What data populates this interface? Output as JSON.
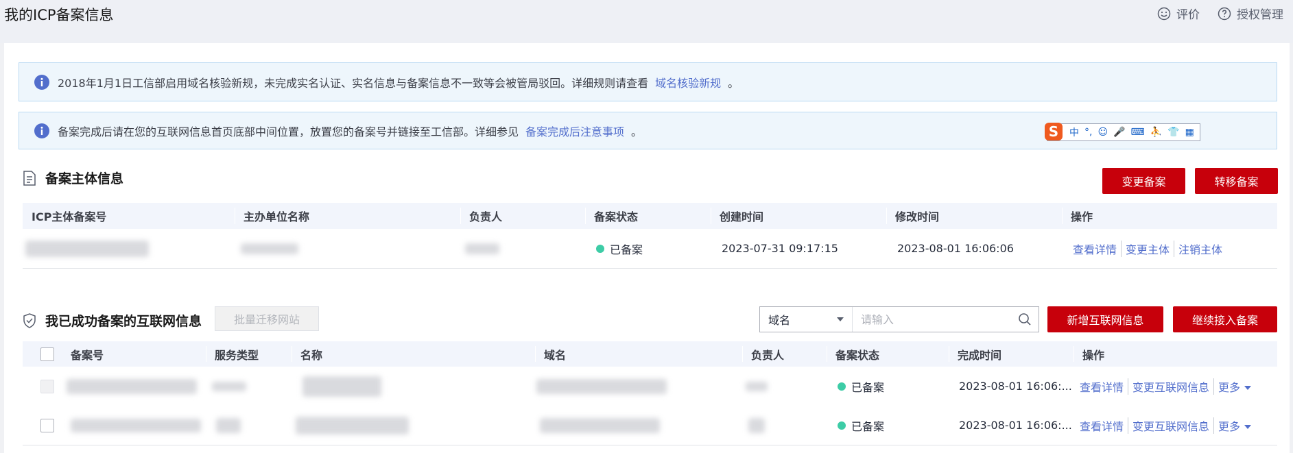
{
  "header": {
    "title": "我的ICP备案信息",
    "rate_label": "评价",
    "auth_label": "授权管理"
  },
  "notices": [
    {
      "text": "2018年1月1日工信部启用域名核验新规，未完成实名认证、实名信息与备案信息不一致等会被管局驳回。详细规则请查看",
      "link": "域名核验新规",
      "end": "。"
    },
    {
      "text": "备案完成后请在您的互联网信息首页底部中间位置，放置您的备案号并链接至工信部。详细参见",
      "link": "备案完成后注意事项",
      "end": "。"
    }
  ],
  "ime_toolbar": {
    "logo": "S",
    "glyphs": [
      "中",
      "°,",
      "☺",
      "🎤",
      "⌨",
      "⛹",
      "👕",
      "▦"
    ]
  },
  "entity": {
    "title": "备案主体信息",
    "buttons": {
      "change": "变更备案",
      "transfer": "转移备案"
    },
    "columns": [
      "ICP主体备案号",
      "主办单位名称",
      "负责人",
      "备案状态",
      "创建时间",
      "修改时间",
      "操作"
    ],
    "row": {
      "status": "已备案",
      "created": "2023-07-31 09:17:15",
      "modified": "2023-08-01 16:06:06",
      "actions": [
        "查看详情",
        "变更主体",
        "注销主体"
      ]
    }
  },
  "sites": {
    "title": "我已成功备案的互联网信息",
    "batch_button": "批量迁移网站",
    "search": {
      "select_value": "域名",
      "placeholder": "请输入"
    },
    "buttons": {
      "add": "新增互联网信息",
      "continue": "继续接入备案"
    },
    "columns": [
      "备案号",
      "服务类型",
      "名称",
      "域名",
      "负责人",
      "备案状态",
      "完成时间",
      "操作"
    ],
    "rows": [
      {
        "status": "已备案",
        "finished": "2023-08-01 16:06:...",
        "actions": [
          "查看详情",
          "变更互联网信息"
        ],
        "more": "更多"
      },
      {
        "status": "已备案",
        "finished": "2023-08-01 16:06:...",
        "actions": [
          "查看详情",
          "变更互联网信息"
        ],
        "more": "更多"
      }
    ]
  },
  "colors": {
    "brand_red": "#c7000b",
    "link_blue": "#526ecc",
    "status_green": "#3dcca6",
    "notice_bg": "#eef6fc"
  }
}
